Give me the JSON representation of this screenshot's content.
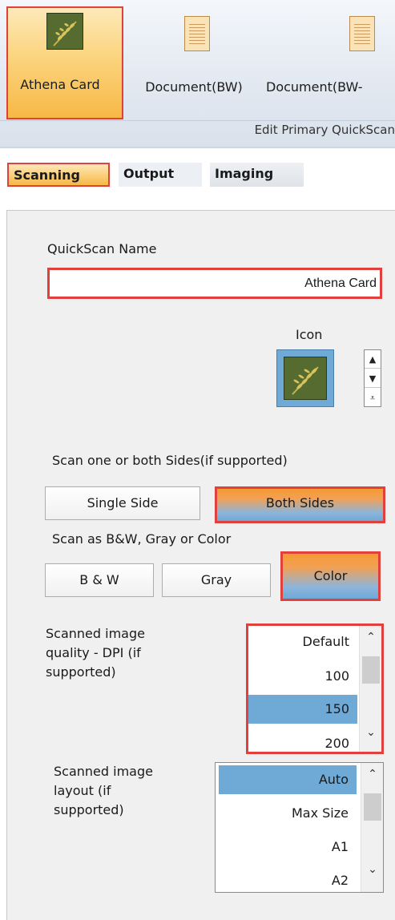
{
  "ribbon": {
    "items": [
      {
        "label": "Athena Card"
      },
      {
        "label": "Document(BW)"
      },
      {
        "label": "Document(BW-"
      }
    ],
    "group_label": "Edit Primary QuickScan"
  },
  "tabs": [
    {
      "label": "Scanning"
    },
    {
      "label": "Output"
    },
    {
      "label": "Imaging"
    }
  ],
  "form": {
    "name_label": "QuickScan Name",
    "name_value": "Athena Card",
    "icon_label": "Icon",
    "sides_label": "Scan one or both Sides(if supported)",
    "sides_options": [
      "Single Side",
      "Both Sides"
    ],
    "sides_selected": "Both Sides",
    "color_label": "Scan as B&W, Gray or Color",
    "color_options": [
      "B & W",
      "Gray",
      "Color"
    ],
    "color_selected": "Color",
    "dpi_label_lines": [
      "Scanned image",
      "quality - DPI (if",
      "supported)"
    ],
    "dpi_options": [
      "Default",
      "100",
      "150",
      "200"
    ],
    "dpi_selected": "150",
    "layout_label_lines": [
      "Scanned image",
      "layout (if",
      "supported)"
    ],
    "layout_options": [
      "Auto",
      "Max Size",
      "A1",
      "A2"
    ],
    "layout_selected": "Auto"
  },
  "colors": {
    "highlight_border": "#e0413c",
    "selection_blue": "#6fa9d6",
    "active_orange": "#f7b846"
  }
}
